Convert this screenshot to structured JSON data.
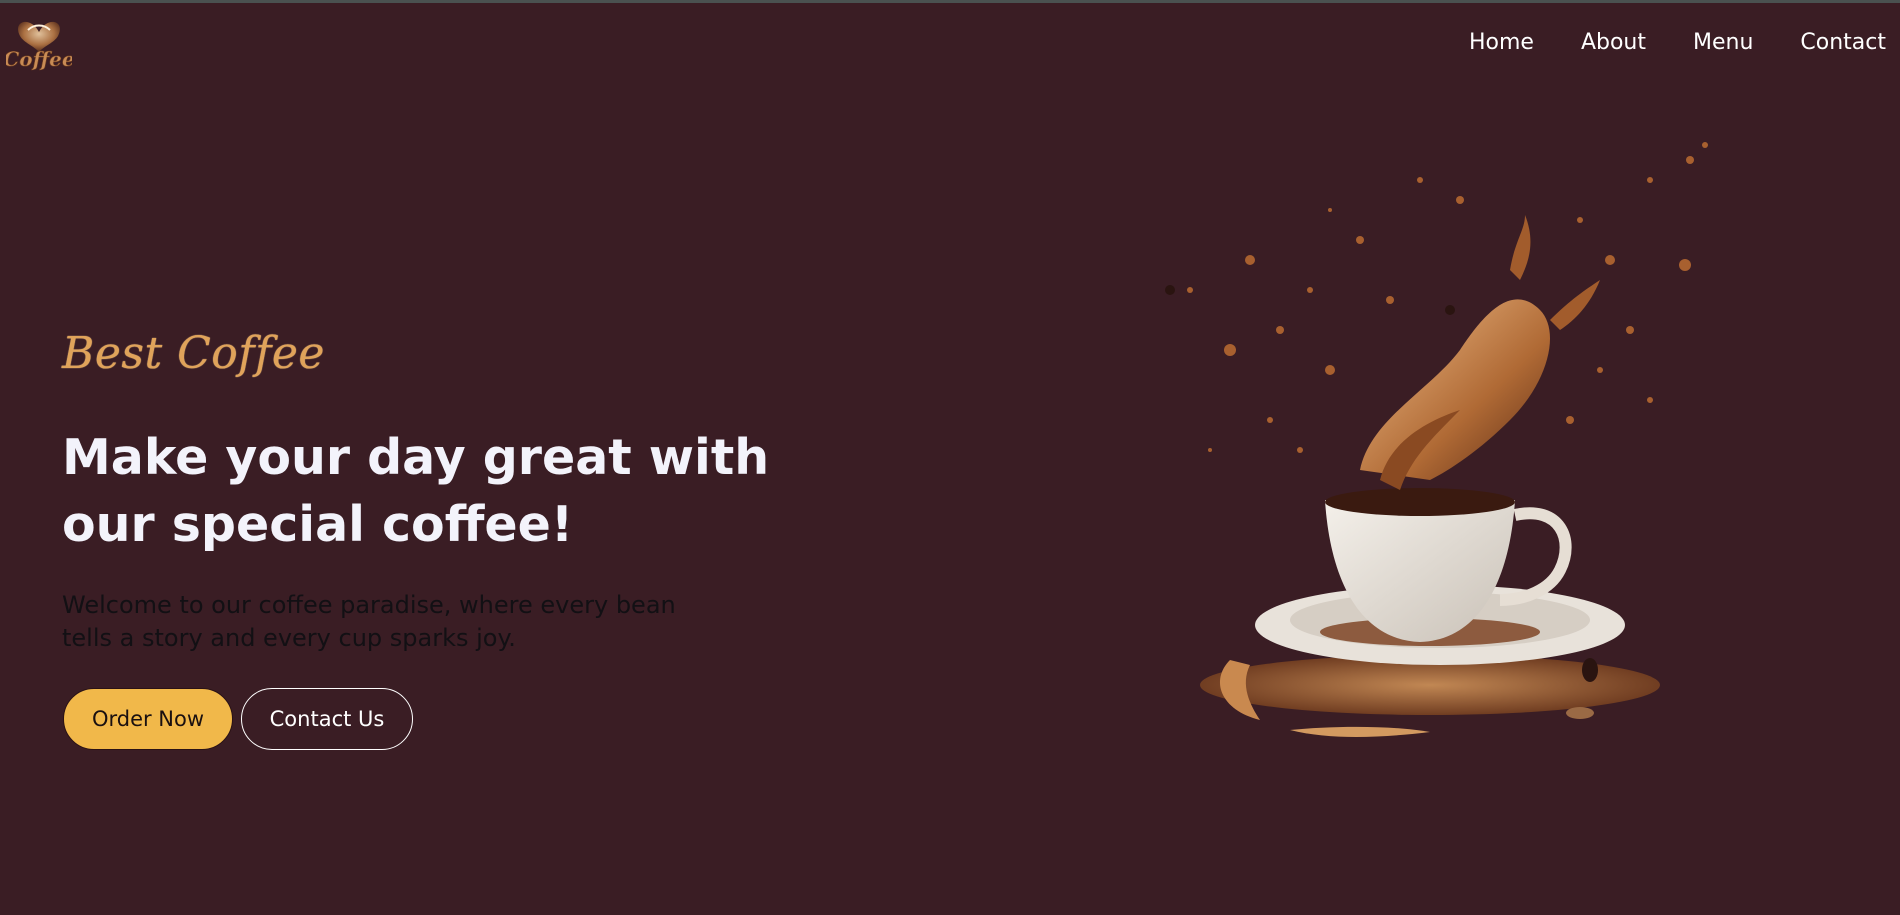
{
  "brand": {
    "logo_text": "Coffee",
    "logo_icon": "coffee-heart-logo"
  },
  "nav": {
    "items": [
      "Home",
      "About",
      "Menu",
      "Contact"
    ]
  },
  "hero": {
    "tagline": "Best Coffee",
    "headline": "Make your day great with our special coffee!",
    "description": "Welcome to our coffee paradise, where every bean tells a story and every cup sparks joy.",
    "primary_button": "Order Now",
    "secondary_button": "Contact Us",
    "image_icon": "coffee-cup-splash-illustration"
  },
  "colors": {
    "background": "#3a1d24",
    "accent": "#f1b84a",
    "tagline": "#e0a35a",
    "headline": "#f3f3fb",
    "body_text": "#121014"
  }
}
